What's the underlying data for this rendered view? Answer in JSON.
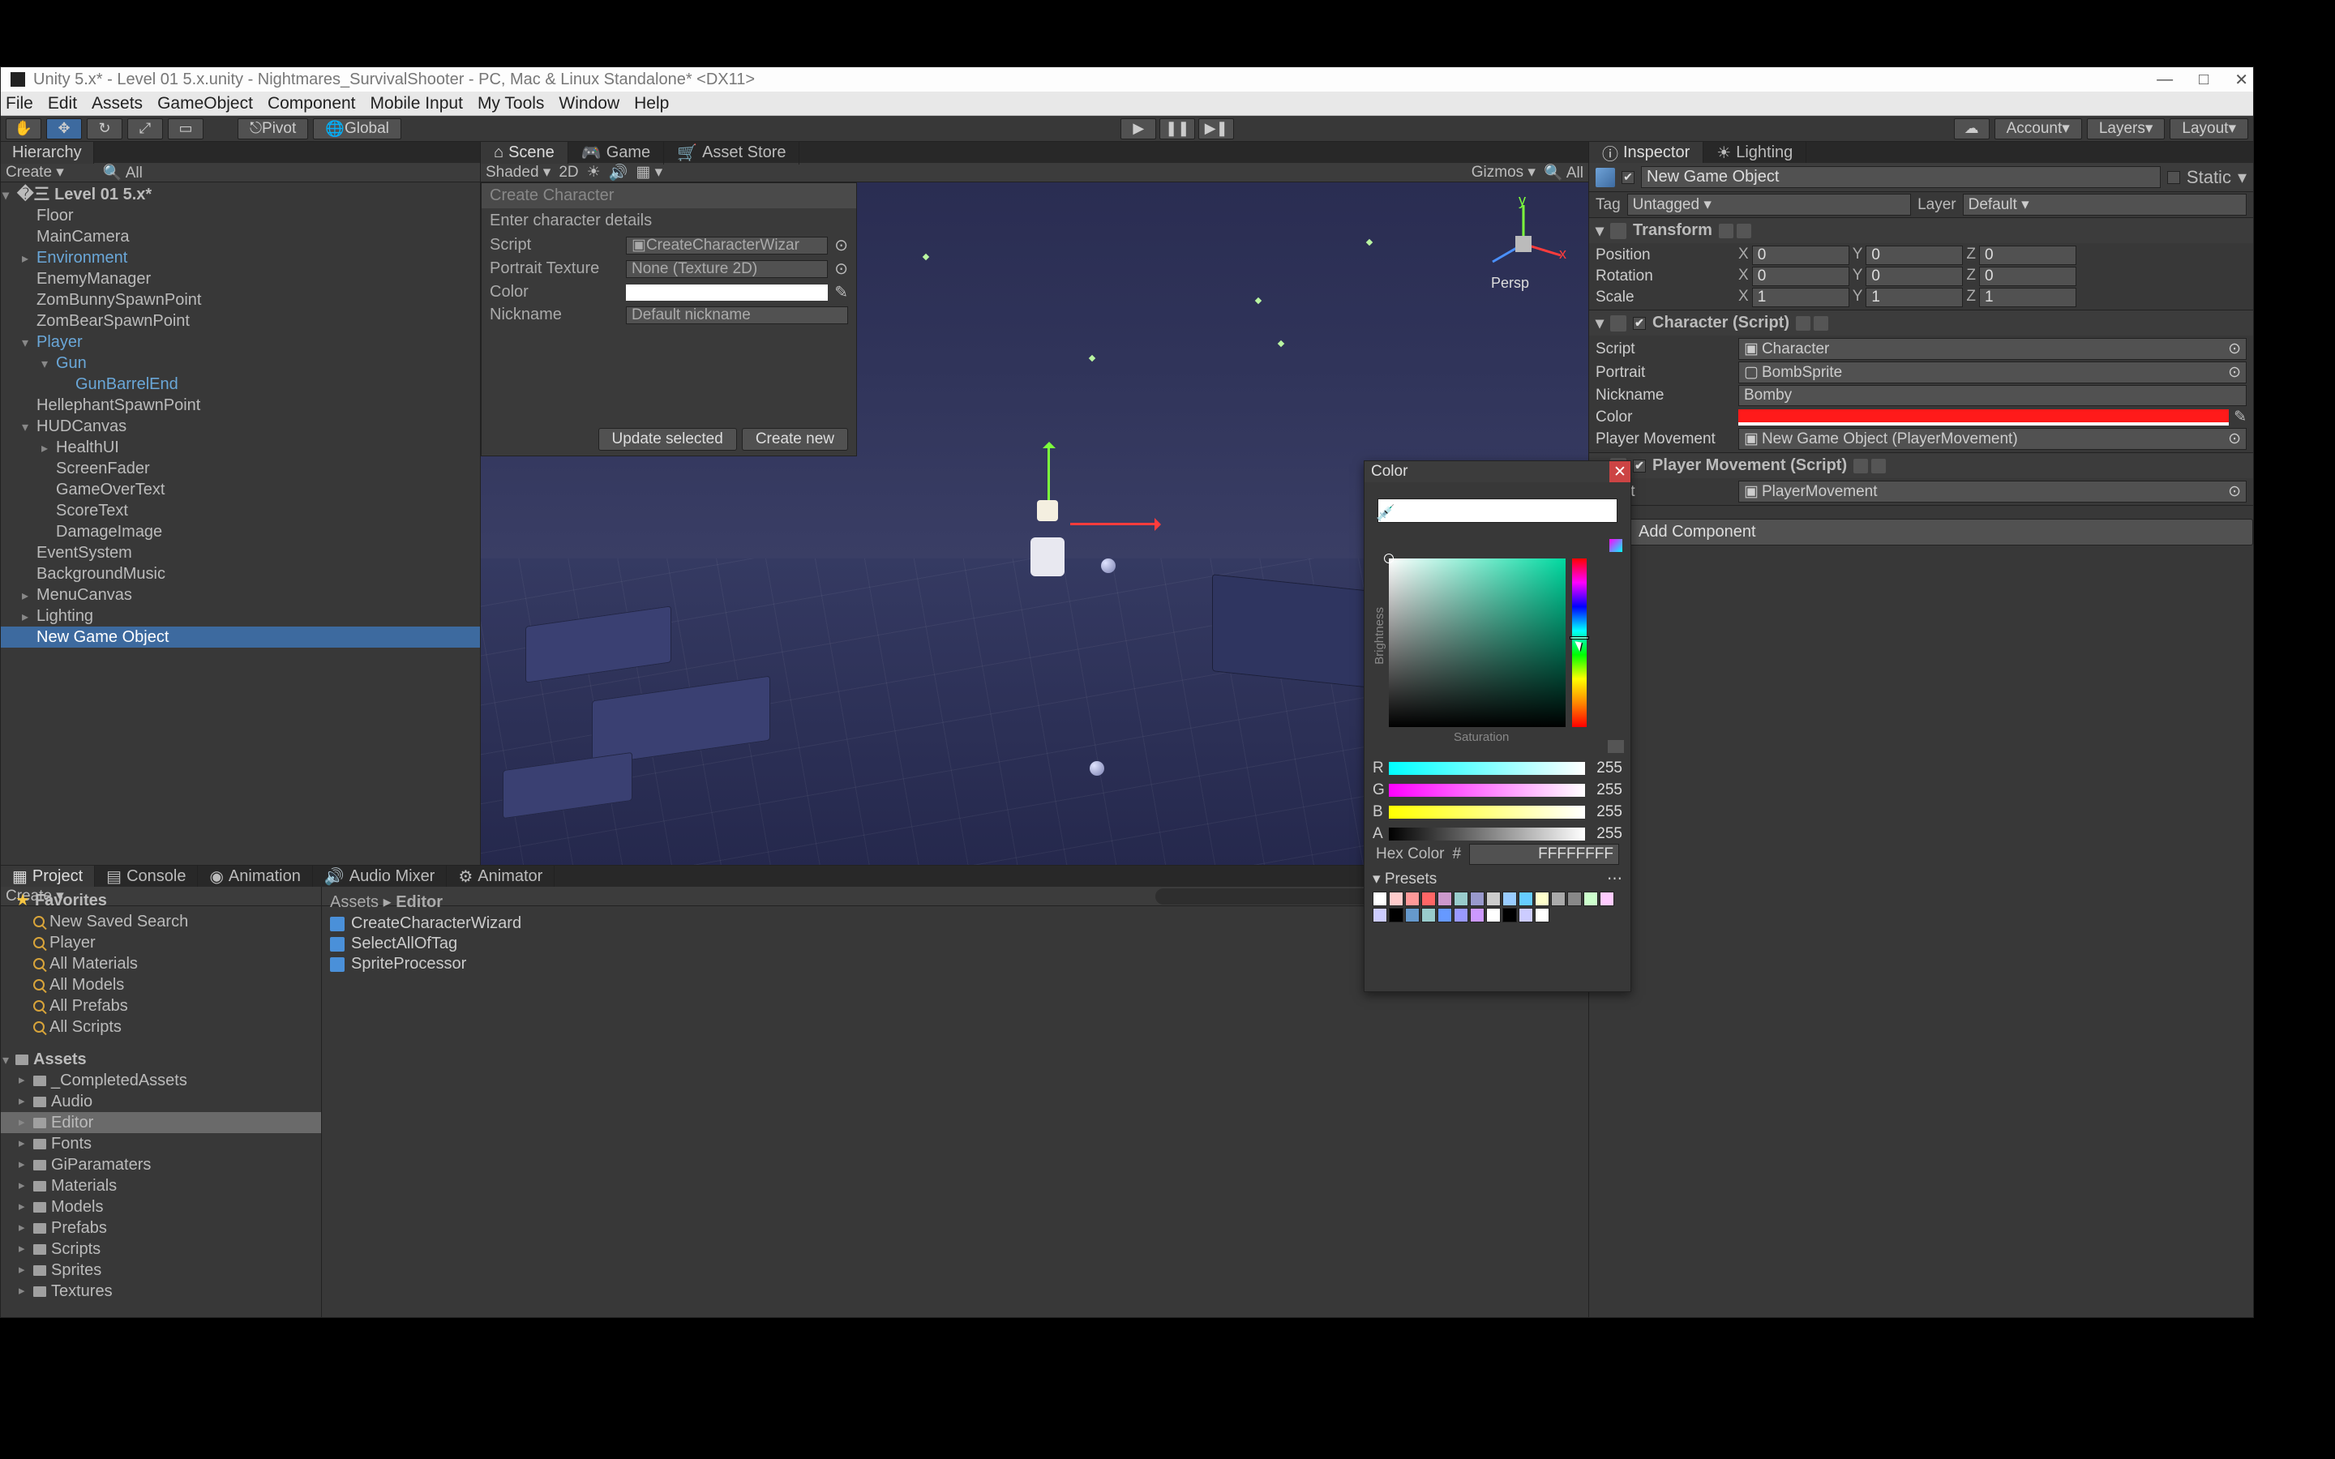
{
  "window": {
    "title": "Unity 5.x* - Level 01 5.x.unity - Nightmares_SurvivalShooter - PC, Mac & Linux Standalone* <DX11>"
  },
  "menu": [
    "File",
    "Edit",
    "Assets",
    "GameObject",
    "Component",
    "Mobile Input",
    "My Tools",
    "Window",
    "Help"
  ],
  "toolbar": {
    "pivot": "Pivot",
    "global": "Global",
    "account": "Account",
    "layers": "Layers",
    "layout": "Layout"
  },
  "hierarchy": {
    "tab": "Hierarchy",
    "create": "Create",
    "search": "All",
    "root": "Level 01 5.x*",
    "items": [
      {
        "label": "Floor",
        "ind": 44
      },
      {
        "label": "MainCamera",
        "ind": 44
      },
      {
        "label": "Environment",
        "ind": 44,
        "blue": true,
        "arrow": "▸"
      },
      {
        "label": "EnemyManager",
        "ind": 44
      },
      {
        "label": "ZomBunnySpawnPoint",
        "ind": 44
      },
      {
        "label": "ZomBearSpawnPoint",
        "ind": 44
      },
      {
        "label": "Player",
        "ind": 44,
        "blue": true,
        "arrow": "▾"
      },
      {
        "label": "Gun",
        "ind": 68,
        "blue": true,
        "arrow": "▾"
      },
      {
        "label": "GunBarrelEnd",
        "ind": 92,
        "blue": true
      },
      {
        "label": "HellephantSpawnPoint",
        "ind": 44
      },
      {
        "label": "HUDCanvas",
        "ind": 44,
        "arrow": "▾"
      },
      {
        "label": "HealthUI",
        "ind": 68,
        "arrow": "▸"
      },
      {
        "label": "ScreenFader",
        "ind": 68
      },
      {
        "label": "GameOverText",
        "ind": 68
      },
      {
        "label": "ScoreText",
        "ind": 68
      },
      {
        "label": "DamageImage",
        "ind": 68
      },
      {
        "label": "EventSystem",
        "ind": 44
      },
      {
        "label": "BackgroundMusic",
        "ind": 44
      },
      {
        "label": "MenuCanvas",
        "ind": 44,
        "arrow": "▸"
      },
      {
        "label": "Lighting",
        "ind": 44,
        "arrow": "▸"
      },
      {
        "label": "New Game Object",
        "ind": 44,
        "sel": true
      }
    ]
  },
  "center": {
    "tabs": [
      "Scene",
      "Game",
      "Asset Store"
    ],
    "shaded": "Shaded",
    "mode2d": "2D",
    "gizmos": "Gizmos",
    "search": "All",
    "persp": "Persp"
  },
  "wizard": {
    "title": "Create Character",
    "subtitle": "Enter character details",
    "rows": {
      "script_lbl": "Script",
      "script_val": "CreateCharacterWizar",
      "portrait_lbl": "Portrait Texture",
      "portrait_val": "None (Texture 2D)",
      "color_lbl": "Color",
      "nickname_lbl": "Nickname",
      "nickname_val": "Default nickname"
    },
    "update_btn": "Update selected",
    "create_btn": "Create new"
  },
  "inspector": {
    "tabs": [
      "Inspector",
      "Lighting"
    ],
    "name": "New Game Object",
    "static": "Static",
    "tag_lbl": "Tag",
    "tag_val": "Untagged",
    "layer_lbl": "Layer",
    "layer_val": "Default",
    "transform": {
      "title": "Transform",
      "pos": "Position",
      "rot": "Rotation",
      "scale": "Scale",
      "px": "0",
      "py": "0",
      "pz": "0",
      "rx": "0",
      "ry": "0",
      "rz": "0",
      "sx": "1",
      "sy": "1",
      "sz": "1"
    },
    "character": {
      "title": "Character (Script)",
      "script_lbl": "Script",
      "script_val": "Character",
      "portrait_lbl": "Portrait",
      "portrait_val": "BombSprite",
      "nickname_lbl": "Nickname",
      "nickname_val": "Bomby",
      "color_lbl": "Color",
      "pm_lbl": "Player Movement",
      "pm_val": "New Game Object (PlayerMovement)"
    },
    "playermove": {
      "title": "Player Movement (Script)",
      "script_lbl": "Script",
      "script_val": "PlayerMovement"
    },
    "add_component": "Add Component"
  },
  "bottom": {
    "tabs": [
      "Project",
      "Console",
      "Animation",
      "Audio Mixer",
      "Animator"
    ],
    "create": "Create",
    "favorites": "Favorites",
    "fav_items": [
      "New Saved Search",
      "Player",
      "All Materials",
      "All Models",
      "All Prefabs",
      "All Scripts"
    ],
    "assets": "Assets",
    "folders": [
      "_CompletedAssets",
      "Audio",
      "Editor",
      "Fonts",
      "GiParamaters",
      "Materials",
      "Models",
      "Prefabs",
      "Scripts",
      "Sprites",
      "Textures"
    ],
    "crumb_assets": "Assets",
    "crumb_sep": "▸",
    "crumb_editor": "Editor",
    "files": [
      "CreateCharacterWizard",
      "SelectAllOfTag",
      "SpriteProcessor"
    ]
  },
  "colorpicker": {
    "title": "Color",
    "brightness": "Brightness",
    "saturation": "Saturation",
    "r": "R",
    "g": "G",
    "b": "B",
    "a": "A",
    "rv": "255",
    "gv": "255",
    "bv": "255",
    "av": "255",
    "hex_lbl": "Hex Color",
    "hash": "#",
    "hex_val": "FFFFFFFF",
    "presets": "Presets",
    "swatches": [
      "#fff",
      "#fcc",
      "#f99",
      "#f66",
      "#c9c",
      "#9cc",
      "#99c",
      "#ccc",
      "#9cf",
      "#6cf",
      "#ffc",
      "#aaa",
      "#888",
      "#cfc",
      "#fcf",
      "#ccf",
      "#000",
      "#69c",
      "#9cc",
      "#69f",
      "#99f",
      "#c9f",
      "#fff",
      "#000",
      "#ccf",
      "#fff"
    ]
  }
}
